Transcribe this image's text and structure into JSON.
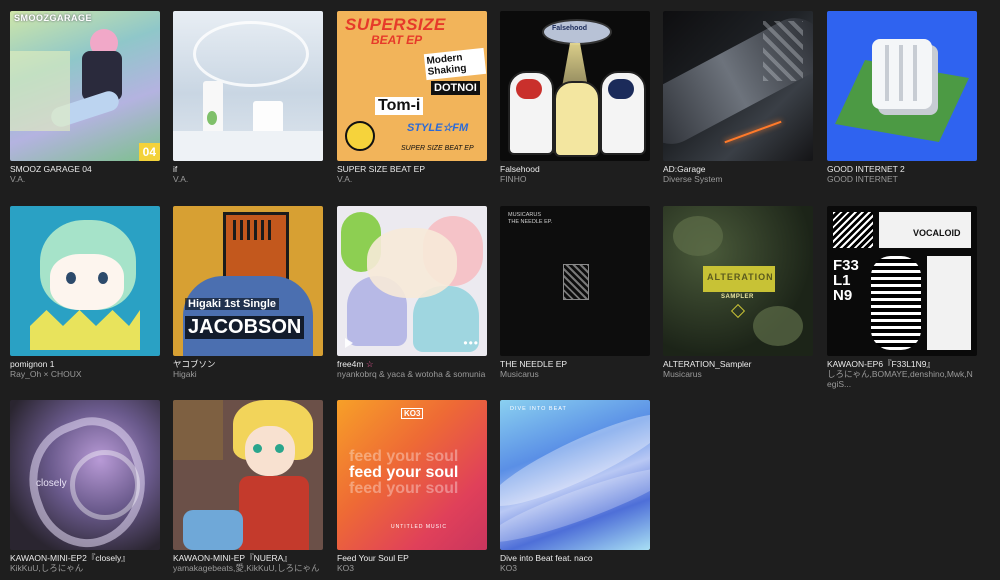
{
  "albums": [
    {
      "title": "SMOOZ GARAGE 04",
      "artist": "V.A.",
      "cover_text": "SMOOZGARAGE",
      "cover_num": "04"
    },
    {
      "title": "if",
      "artist": "V.A."
    },
    {
      "title": "SUPER SIZE BEAT EP",
      "artist": "V.A.",
      "cover_text": "SUPERSIZE",
      "cover_text2": "BEAT EP",
      "cover_text3": "Modern Shaking",
      "cover_text4": "DOTNOI",
      "cover_text5": "Tom-i",
      "cover_text6": "STYLE☆FM",
      "cover_text7": "SUPER SIZE BEAT EP"
    },
    {
      "title": "Falsehood",
      "artist": "FINHO",
      "cover_text": "Falsehood"
    },
    {
      "title": "AD:Garage",
      "artist": "Diverse System"
    },
    {
      "title": "GOOD INTERNET 2",
      "artist": "GOOD INTERNET"
    },
    {
      "title": "pomignon 1",
      "artist": "Ray_Oh × CHOUX"
    },
    {
      "title": "ヤコブソン",
      "artist": "Higaki",
      "cover_text": "Higaki 1st Single",
      "cover_text2": "JACOBSON"
    },
    {
      "title": "free4m",
      "artist": "nyankobrq & yaca & wotoha & somunia",
      "badge": "☆"
    },
    {
      "title": "THE NEEDLE EP",
      "artist": "Musicarus",
      "cover_text": "MUSICARUS",
      "cover_text2": "THE NEEDLE EP."
    },
    {
      "title": "ALTERATION_Sampler",
      "artist": "Musicarus",
      "cover_text": "ALTERATION",
      "cover_text2": "SAMPLER"
    },
    {
      "title": "KAWAON-EP6『F33L1N9』",
      "artist": "しろにゃん,BOMAYE,denshino,Mwk,NegiS...",
      "cover_text": "VOCALOID",
      "cover_text2": "F33L1N9"
    },
    {
      "title": "KAWAON-MINI-EP2『closely』",
      "artist": "KikKuU,しろにゃん",
      "cover_text": "closely"
    },
    {
      "title": "KAWAON-MINI-EP『NUERA』",
      "artist": "yamakagebeats,愛,KikKuU,しろにゃん"
    },
    {
      "title": "Feed Your Soul EP",
      "artist": "KO3",
      "cover_text": "KO3",
      "cover_text2": "feed your soul",
      "cover_text3": "UNTITLED MUSIC"
    },
    {
      "title": "Dive into Beat feat. naco",
      "artist": "KO3",
      "cover_text": "DIVE INTO BEAT"
    }
  ]
}
